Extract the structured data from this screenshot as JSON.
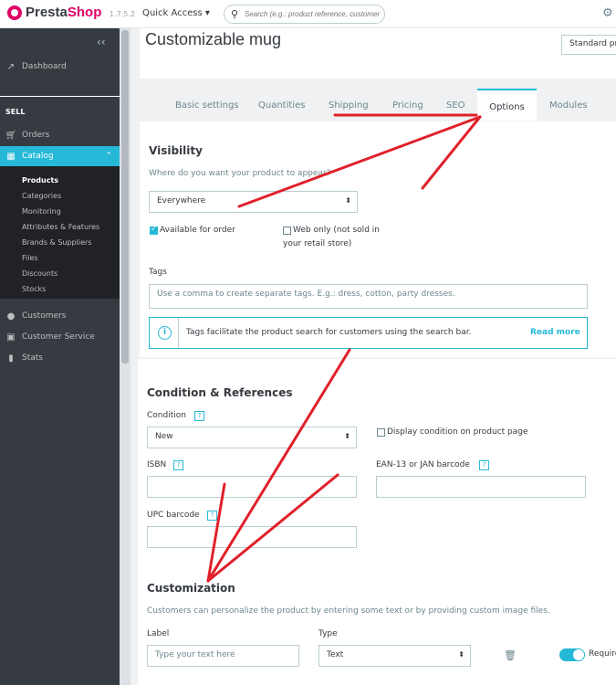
{
  "topbar": {
    "logo_text_a": "Presta",
    "logo_text_b": "Shop",
    "version": "1.7.5.2",
    "quick_access": "Quick Access",
    "search_placeholder": "Search (e.g.: product reference, customer name...)"
  },
  "sidebar": {
    "dashboard": "Dashboard",
    "sell_header": "SELL",
    "orders": "Orders",
    "catalog": "Catalog",
    "catalog_items": [
      "Products",
      "Categories",
      "Monitoring",
      "Attributes & Features",
      "Brands & Suppliers",
      "Files",
      "Discounts",
      "Stocks"
    ],
    "customers": "Customers",
    "customer_service": "Customer Service",
    "stats": "Stats"
  },
  "product": {
    "title": "Customizable mug",
    "type_select": "Standard pr"
  },
  "tabs": [
    "Basic settings",
    "Quantities",
    "Shipping",
    "Pricing",
    "SEO",
    "Options",
    "Modules"
  ],
  "visibility": {
    "title": "Visibility",
    "question": "Where do you want your product to appear?",
    "value": "Everywhere",
    "available_for_order": "Available for order",
    "web_only_1": "Web only (not sold in",
    "web_only_2": "your retail store)"
  },
  "tags": {
    "label": "Tags",
    "placeholder": "Use a comma to create separate tags. E.g.: dress, cotton, party dresses.",
    "info": "Tags facilitate the product search for customers using the search bar.",
    "read_more": "Read more"
  },
  "condition": {
    "title": "Condition & References",
    "label": "Condition",
    "value": "New",
    "display_condition": "Display condition on product page",
    "isbn": "ISBN",
    "ean": "EAN-13 or JAN barcode",
    "upc": "UPC barcode",
    "help": "?"
  },
  "customization": {
    "title": "Customization",
    "description": "Customers can personalize the product by entering some text or by providing custom image files.",
    "label_header": "Label",
    "type_header": "Type",
    "label_placeholder": "Type your text here",
    "type_value": "Text",
    "required": "Required"
  },
  "colors": {
    "accent": "#25b9d7",
    "brand": "#df0067",
    "sidebar": "#363a41",
    "annotation": "#e0202a"
  }
}
